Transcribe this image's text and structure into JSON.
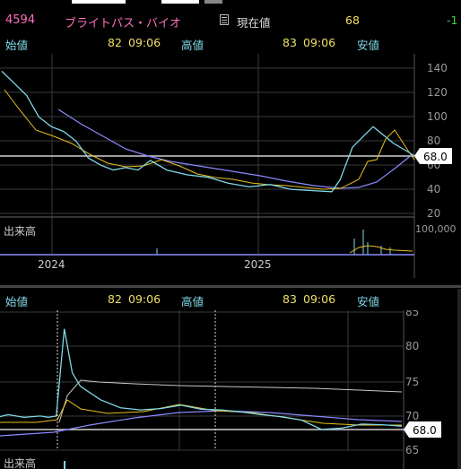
{
  "header": {
    "code": "4594",
    "name": "ブライトパス・バイオ",
    "current_label": "現在値",
    "current_value": "68",
    "change": "-1"
  },
  "info_row": {
    "open_label": "始値",
    "open_value": "82",
    "open_time": "09:06",
    "high_label": "高値",
    "high_value": "83",
    "high_time": "09:06",
    "low_label": "安値"
  },
  "colors": {
    "price_line": "#7fd8e8",
    "ma_short": "#e8c020",
    "ma_mid": "#8a8aff",
    "ma_long": "#c8c8c8",
    "label_cyan": "#7fd8e8",
    "label_pink": "#ff6fbf",
    "label_yellow": "#f0e060",
    "label_green": "#40d040"
  },
  "chart_data": [
    {
      "type": "line",
      "panel": "daily",
      "yticks": [
        140,
        120,
        100,
        80,
        60,
        40,
        20
      ],
      "ylim": [
        20,
        145
      ],
      "xtick_labels": [
        "2024",
        "2025"
      ],
      "current_price_label": "68.0",
      "volume_label": "出来高",
      "volume_tick": "100,000",
      "x": [
        0,
        3,
        6,
        9,
        12,
        15,
        18,
        21,
        24,
        27,
        30,
        33,
        36,
        40,
        45,
        50,
        55,
        60,
        65,
        70,
        75,
        80,
        82,
        85,
        90,
        95,
        100
      ],
      "values": [
        138,
        128,
        118,
        100,
        92,
        88,
        80,
        66,
        60,
        56,
        58,
        56,
        64,
        56,
        52,
        50,
        45,
        42,
        44,
        40,
        39,
        38,
        48,
        75,
        92,
        78,
        68
      ]
    },
    {
      "type": "line",
      "panel": "intraday",
      "yticks": [
        85,
        80,
        75,
        70,
        65
      ],
      "ylim": [
        64,
        85
      ],
      "current_price_label": "68.0",
      "volume_label": "出来高",
      "x": [
        0,
        2,
        4,
        6,
        8,
        10,
        12,
        14,
        16,
        18,
        20,
        25,
        30,
        35,
        40,
        45,
        50,
        55,
        60,
        65,
        70,
        75,
        80,
        85,
        90,
        95,
        100
      ],
      "values": [
        69.5,
        69.8,
        69.6,
        69.4,
        69.5,
        69.6,
        69.4,
        69.6,
        82.5,
        76,
        74,
        72,
        70.8,
        70.5,
        70.7,
        71.2,
        70.6,
        70.5,
        70.2,
        69.8,
        69.5,
        69,
        67.6,
        67.8,
        68.4,
        68.3,
        68.1
      ]
    }
  ]
}
